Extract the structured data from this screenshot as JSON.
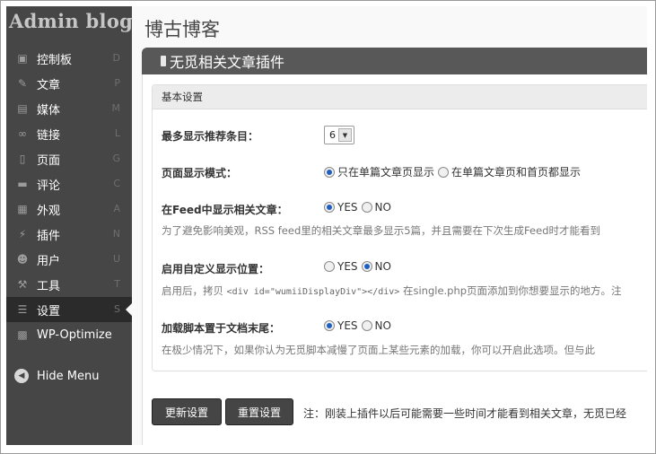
{
  "sidebar": {
    "logo": "Admin blog",
    "items": [
      {
        "label": "控制板",
        "key": "D",
        "icon": "dashboard-icon",
        "glyph": "▣"
      },
      {
        "label": "文章",
        "key": "P",
        "icon": "pin-icon",
        "glyph": "✎"
      },
      {
        "label": "媒体",
        "key": "M",
        "icon": "media-icon",
        "glyph": "▤"
      },
      {
        "label": "链接",
        "key": "L",
        "icon": "link-icon",
        "glyph": "∞"
      },
      {
        "label": "页面",
        "key": "G",
        "icon": "page-icon",
        "glyph": "▯"
      },
      {
        "label": "评论",
        "key": "C",
        "icon": "comment-icon",
        "glyph": "▬"
      },
      {
        "label": "外观",
        "key": "A",
        "icon": "appearance-icon",
        "glyph": "▦"
      },
      {
        "label": "插件",
        "key": "N",
        "icon": "plugin-icon",
        "glyph": "⚡"
      },
      {
        "label": "用户",
        "key": "U",
        "icon": "users-icon",
        "glyph": "☻"
      },
      {
        "label": "工具",
        "key": "T",
        "icon": "tools-icon",
        "glyph": "⚒"
      },
      {
        "label": "设置",
        "key": "S",
        "icon": "settings-icon",
        "glyph": "☰"
      },
      {
        "label": "WP-Optimize",
        "key": "",
        "icon": "optimize-icon",
        "glyph": "▩"
      }
    ],
    "active_index": 10,
    "hide_menu": "Hide Menu"
  },
  "header": {
    "site_title": "博古博客",
    "plugin_title": "无觅相关文章插件"
  },
  "settings": {
    "section_title": "基本设置",
    "max_items": {
      "label": "最多显示推荐条目：",
      "value": "6"
    },
    "display_mode": {
      "label": "页面显示模式：",
      "option_a": "只在单篇文章页显示",
      "option_b": "在单篇文章页和首页都显示",
      "selected": "option_a"
    },
    "feed": {
      "label": "在Feed中显示相关文章：",
      "yes": "YES",
      "no": "NO",
      "selected": "yes",
      "desc": "为了避免影响美观，RSS feed里的相关文章最多显示5篇，并且需要在下次生成Feed时才能看到"
    },
    "custom_position": {
      "label": "启用自定义显示位置：",
      "yes": "YES",
      "no": "NO",
      "selected": "no",
      "desc_before": "启用后，拷贝 ",
      "desc_code": "<div id=\"wumiiDisplayDiv\"></div>",
      "desc_after": " 在single.php页面添加到你想要显示的地方。注"
    },
    "load_footer": {
      "label": "加载脚本置于文档末尾：",
      "yes": "YES",
      "no": "NO",
      "selected": "yes",
      "desc": "在极少情况下，如果你认为无觅脚本减慢了页面上某些元素的加载，你可以开启此选项。但与此"
    }
  },
  "actions": {
    "update": "更新设置",
    "reset": "重置设置",
    "note": "注：刚装上插件以后可能需要一些时间才能看到相关文章，无觅已经"
  }
}
